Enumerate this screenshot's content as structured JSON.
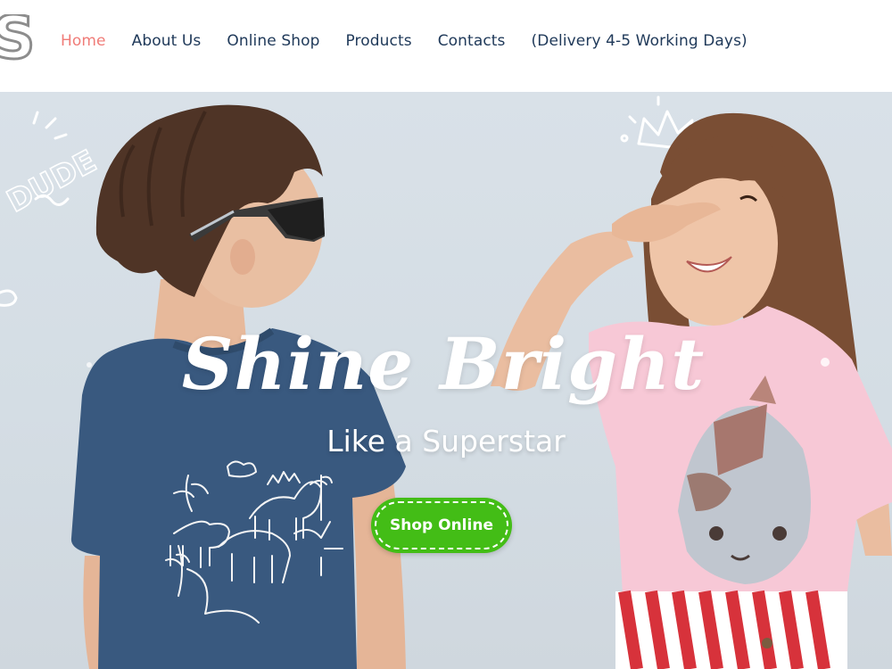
{
  "header": {
    "logo_letter": "S",
    "nav": [
      {
        "label": "Home",
        "active": true
      },
      {
        "label": "About Us",
        "active": false
      },
      {
        "label": "Online Shop",
        "active": false
      },
      {
        "label": "Products",
        "active": false
      },
      {
        "label": "Contacts",
        "active": false
      },
      {
        "label": "(Delivery 4-5 Working Days)",
        "active": false
      }
    ]
  },
  "hero": {
    "headline": "Shine Bright",
    "subheadline": "Like a Superstar",
    "cta_label": "Shop Online",
    "doodle_text": "DUDE"
  },
  "colors": {
    "nav_text": "#203a5a",
    "nav_active": "#f07c78",
    "cta_green": "#43bd16",
    "hero_background": "#d6dee5"
  }
}
